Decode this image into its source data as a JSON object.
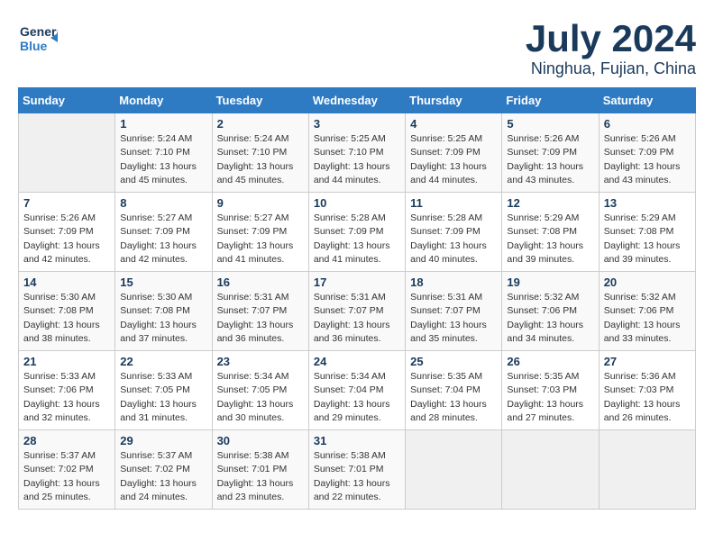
{
  "header": {
    "logo_line1": "General",
    "logo_line2": "Blue",
    "month": "July 2024",
    "location": "Ninghua, Fujian, China"
  },
  "weekdays": [
    "Sunday",
    "Monday",
    "Tuesday",
    "Wednesday",
    "Thursday",
    "Friday",
    "Saturday"
  ],
  "weeks": [
    [
      {
        "day": "",
        "info": ""
      },
      {
        "day": "1",
        "info": "Sunrise: 5:24 AM\nSunset: 7:10 PM\nDaylight: 13 hours\nand 45 minutes."
      },
      {
        "day": "2",
        "info": "Sunrise: 5:24 AM\nSunset: 7:10 PM\nDaylight: 13 hours\nand 45 minutes."
      },
      {
        "day": "3",
        "info": "Sunrise: 5:25 AM\nSunset: 7:10 PM\nDaylight: 13 hours\nand 44 minutes."
      },
      {
        "day": "4",
        "info": "Sunrise: 5:25 AM\nSunset: 7:09 PM\nDaylight: 13 hours\nand 44 minutes."
      },
      {
        "day": "5",
        "info": "Sunrise: 5:26 AM\nSunset: 7:09 PM\nDaylight: 13 hours\nand 43 minutes."
      },
      {
        "day": "6",
        "info": "Sunrise: 5:26 AM\nSunset: 7:09 PM\nDaylight: 13 hours\nand 43 minutes."
      }
    ],
    [
      {
        "day": "7",
        "info": "Sunrise: 5:26 AM\nSunset: 7:09 PM\nDaylight: 13 hours\nand 42 minutes."
      },
      {
        "day": "8",
        "info": "Sunrise: 5:27 AM\nSunset: 7:09 PM\nDaylight: 13 hours\nand 42 minutes."
      },
      {
        "day": "9",
        "info": "Sunrise: 5:27 AM\nSunset: 7:09 PM\nDaylight: 13 hours\nand 41 minutes."
      },
      {
        "day": "10",
        "info": "Sunrise: 5:28 AM\nSunset: 7:09 PM\nDaylight: 13 hours\nand 41 minutes."
      },
      {
        "day": "11",
        "info": "Sunrise: 5:28 AM\nSunset: 7:09 PM\nDaylight: 13 hours\nand 40 minutes."
      },
      {
        "day": "12",
        "info": "Sunrise: 5:29 AM\nSunset: 7:08 PM\nDaylight: 13 hours\nand 39 minutes."
      },
      {
        "day": "13",
        "info": "Sunrise: 5:29 AM\nSunset: 7:08 PM\nDaylight: 13 hours\nand 39 minutes."
      }
    ],
    [
      {
        "day": "14",
        "info": "Sunrise: 5:30 AM\nSunset: 7:08 PM\nDaylight: 13 hours\nand 38 minutes."
      },
      {
        "day": "15",
        "info": "Sunrise: 5:30 AM\nSunset: 7:08 PM\nDaylight: 13 hours\nand 37 minutes."
      },
      {
        "day": "16",
        "info": "Sunrise: 5:31 AM\nSunset: 7:07 PM\nDaylight: 13 hours\nand 36 minutes."
      },
      {
        "day": "17",
        "info": "Sunrise: 5:31 AM\nSunset: 7:07 PM\nDaylight: 13 hours\nand 36 minutes."
      },
      {
        "day": "18",
        "info": "Sunrise: 5:31 AM\nSunset: 7:07 PM\nDaylight: 13 hours\nand 35 minutes."
      },
      {
        "day": "19",
        "info": "Sunrise: 5:32 AM\nSunset: 7:06 PM\nDaylight: 13 hours\nand 34 minutes."
      },
      {
        "day": "20",
        "info": "Sunrise: 5:32 AM\nSunset: 7:06 PM\nDaylight: 13 hours\nand 33 minutes."
      }
    ],
    [
      {
        "day": "21",
        "info": "Sunrise: 5:33 AM\nSunset: 7:06 PM\nDaylight: 13 hours\nand 32 minutes."
      },
      {
        "day": "22",
        "info": "Sunrise: 5:33 AM\nSunset: 7:05 PM\nDaylight: 13 hours\nand 31 minutes."
      },
      {
        "day": "23",
        "info": "Sunrise: 5:34 AM\nSunset: 7:05 PM\nDaylight: 13 hours\nand 30 minutes."
      },
      {
        "day": "24",
        "info": "Sunrise: 5:34 AM\nSunset: 7:04 PM\nDaylight: 13 hours\nand 29 minutes."
      },
      {
        "day": "25",
        "info": "Sunrise: 5:35 AM\nSunset: 7:04 PM\nDaylight: 13 hours\nand 28 minutes."
      },
      {
        "day": "26",
        "info": "Sunrise: 5:35 AM\nSunset: 7:03 PM\nDaylight: 13 hours\nand 27 minutes."
      },
      {
        "day": "27",
        "info": "Sunrise: 5:36 AM\nSunset: 7:03 PM\nDaylight: 13 hours\nand 26 minutes."
      }
    ],
    [
      {
        "day": "28",
        "info": "Sunrise: 5:37 AM\nSunset: 7:02 PM\nDaylight: 13 hours\nand 25 minutes."
      },
      {
        "day": "29",
        "info": "Sunrise: 5:37 AM\nSunset: 7:02 PM\nDaylight: 13 hours\nand 24 minutes."
      },
      {
        "day": "30",
        "info": "Sunrise: 5:38 AM\nSunset: 7:01 PM\nDaylight: 13 hours\nand 23 minutes."
      },
      {
        "day": "31",
        "info": "Sunrise: 5:38 AM\nSunset: 7:01 PM\nDaylight: 13 hours\nand 22 minutes."
      },
      {
        "day": "",
        "info": ""
      },
      {
        "day": "",
        "info": ""
      },
      {
        "day": "",
        "info": ""
      }
    ]
  ]
}
